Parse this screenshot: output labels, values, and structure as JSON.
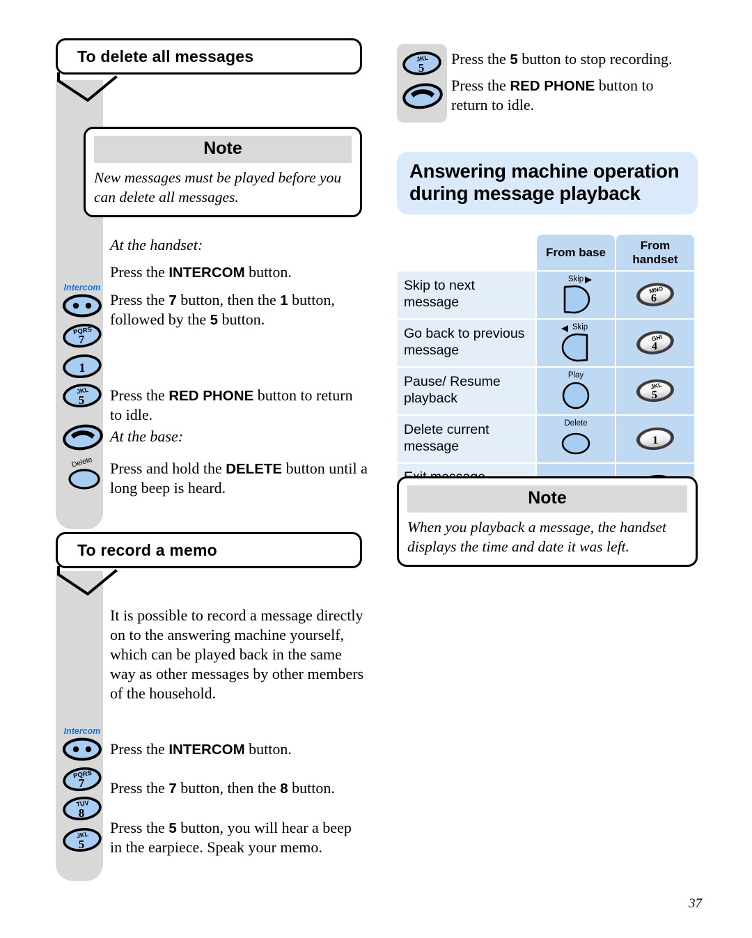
{
  "page": {
    "number": "37",
    "colors": {
      "rail_grey": "#d8d8d8",
      "note_header_grey": "#d9d9d9",
      "heading_blue": "#daeafb",
      "table_icon_blue": "#bfd9f2",
      "table_label_blue": "#e3eef9",
      "key_blue": "#a8cdf2",
      "intercom_label_blue": "#1a74d4"
    }
  },
  "left_column": {
    "section1": {
      "callout_title": "To delete all messages",
      "note": {
        "header": "Note",
        "body": "New messages must be played before you can delete all messages."
      },
      "subhead_handset": "At the handset:",
      "steps_handset": [
        {
          "text_before": "Press the ",
          "bold": "INTERCOM",
          "text_after": " button.",
          "key": "intercom"
        },
        {
          "text_before": "Press the ",
          "bold": "7",
          "text_after": " button, then the ",
          "bold2": "1",
          "text_after2": " button, followed by the ",
          "bold3": "5",
          "text_after3": " button.",
          "key": "7"
        }
      ],
      "step_7_label": "PQRS",
      "step_7_digit": "7",
      "step_1_digit": "1",
      "step_5_label": "JKL",
      "step_5_digit": "5",
      "intercom_label": "Intercom",
      "redphone_step": {
        "text_before": "Press the ",
        "bold": "RED PHONE",
        "text_after": " button to return to idle."
      },
      "subhead_base": "At the base:",
      "delete_label": "Delete",
      "delete_step": {
        "text_before": "Press and hold the ",
        "bold": "DELETE",
        "text_after": " button until a long beep is heard."
      }
    },
    "section2": {
      "callout_title": "To record a memo",
      "intro": "It is possible to record a message directly on to the answering machine yourself, which can be played back in the same way as other messages by other members of the household.",
      "intercom_label": "Intercom",
      "steps": [
        {
          "text_before": "Press the ",
          "bold": "INTERCOM",
          "text_after": " button."
        },
        {
          "text_before": "Press the ",
          "bold": "7",
          "text_after": " button, then the ",
          "bold2": "8",
          "text_after2": " button."
        },
        {
          "text_before": "Press the ",
          "bold": "5",
          "text_after": " button, you will hear a beep in the earpiece. Speak your memo."
        }
      ],
      "key_7_label": "PQRS",
      "key_7_digit": "7",
      "key_8_label": "TUV",
      "key_8_digit": "8",
      "key_5_label": "JKL",
      "key_5_digit": "5"
    }
  },
  "right_column": {
    "top_steps": [
      {
        "text_before": "Press the ",
        "bold": "5",
        "text_after": " button to stop recording."
      },
      {
        "text_before": "Press the ",
        "bold": "RED PHONE",
        "text_after": " button to return to idle."
      }
    ],
    "key_5_label": "JKL",
    "key_5_digit": "5",
    "section_heading": "Answering machine operation during message playback",
    "table": {
      "headers": [
        "",
        "From base",
        "From handset"
      ],
      "rows": [
        {
          "label": "Skip to next message",
          "base": {
            "type": "skip-forward",
            "caption": "Skip",
            "arrow": "right"
          },
          "handset": {
            "type": "digit-key",
            "letters": "MNO",
            "digit": "6"
          }
        },
        {
          "label": "Go back to previous message",
          "base": {
            "type": "skip-back",
            "caption": "Skip",
            "arrow": "left"
          },
          "handset": {
            "type": "digit-key",
            "letters": "GHI",
            "digit": "4"
          }
        },
        {
          "label": "Pause/ Resume playback",
          "base": {
            "type": "round-key",
            "caption": "Play"
          },
          "handset": {
            "type": "digit-key",
            "letters": "JKL",
            "digit": "5"
          }
        },
        {
          "label": "Delete current message",
          "base": {
            "type": "round-key",
            "caption": "Delete"
          },
          "handset": {
            "type": "digit-key",
            "letters": "",
            "digit": "1"
          }
        },
        {
          "label": "Exit message playback",
          "base": {
            "type": "none",
            "caption": ""
          },
          "handset": {
            "type": "red-phone",
            "letters": "",
            "digit": ""
          }
        }
      ]
    },
    "note": {
      "header": "Note",
      "body": "When you playback a message, the handset displays the time and date it was left."
    }
  }
}
